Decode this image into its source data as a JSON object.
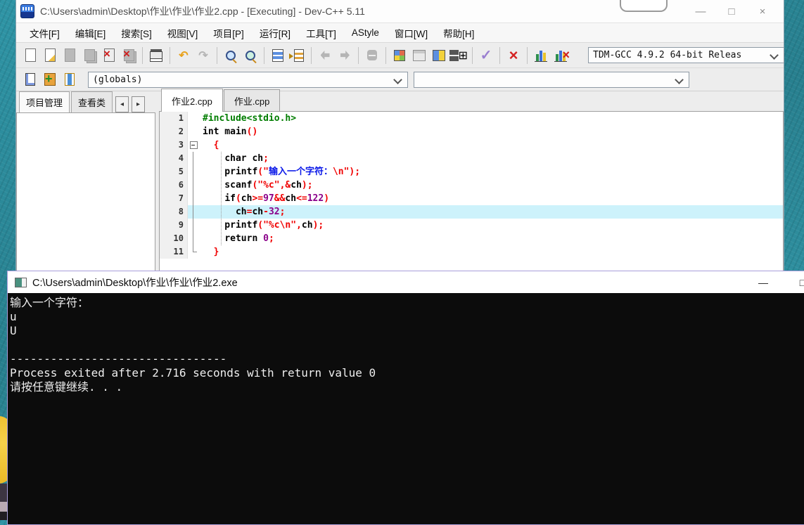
{
  "devcpp": {
    "title": "C:\\Users\\admin\\Desktop\\作业\\作业\\作业2.cpp - [Executing] - Dev-C++ 5.11",
    "window_buttons": {
      "minimize": "—",
      "maximize": "□",
      "close": "×"
    },
    "menu": [
      "文件[F]",
      "编辑[E]",
      "搜索[S]",
      "视图[V]",
      "项目[P]",
      "运行[R]",
      "工具[T]",
      "AStyle",
      "窗口[W]",
      "帮助[H]"
    ],
    "toolbar_main": [
      {
        "name": "new-source",
        "kind": "page"
      },
      {
        "name": "open",
        "kind": "page-open"
      },
      {
        "name": "save",
        "kind": "page-gray"
      },
      {
        "name": "save-all",
        "kind": "pages-gray"
      },
      {
        "name": "close",
        "kind": "page-x"
      },
      {
        "name": "close-all",
        "kind": "pages-x"
      },
      {
        "kind": "sep"
      },
      {
        "name": "print",
        "kind": "printer"
      },
      {
        "kind": "sep"
      },
      {
        "name": "undo",
        "kind": "undo",
        "glyph": "↶"
      },
      {
        "name": "redo",
        "kind": "redo",
        "glyph": "↷"
      },
      {
        "kind": "sep"
      },
      {
        "name": "find",
        "kind": "find"
      },
      {
        "name": "find-in-files",
        "kind": "findfiles"
      },
      {
        "kind": "sep"
      },
      {
        "name": "goto-line",
        "kind": "gotoline"
      },
      {
        "name": "goto-function",
        "kind": "gotofn"
      },
      {
        "kind": "sep"
      },
      {
        "name": "back",
        "kind": "back"
      },
      {
        "name": "forward",
        "kind": "fwd"
      },
      {
        "kind": "sep"
      },
      {
        "name": "comment",
        "kind": "stopgray"
      },
      {
        "kind": "sep"
      },
      {
        "name": "compile",
        "kind": "compile"
      },
      {
        "name": "run",
        "kind": "run"
      },
      {
        "name": "compile-and-run",
        "kind": "comprun"
      },
      {
        "name": "rebuild-all",
        "kind": "rebuild",
        "glyph": "⊞"
      },
      {
        "kind": "sep"
      },
      {
        "name": "syntax-check",
        "kind": "check",
        "glyph": "✓"
      },
      {
        "kind": "sep"
      },
      {
        "name": "abort-compilation",
        "kind": "abort",
        "glyph": "×"
      },
      {
        "kind": "sep"
      },
      {
        "name": "profile-analysis",
        "kind": "profile"
      },
      {
        "name": "delete-profiling",
        "kind": "profdel"
      }
    ],
    "compiler_combo_value": "TDM-GCC 4.9.2 64-bit Releas",
    "toolbar_project": [
      {
        "name": "new-unit",
        "kind": "newunit"
      },
      {
        "name": "add-to-project",
        "kind": "addfile"
      },
      {
        "name": "remove-from-project",
        "kind": "removefile"
      }
    ],
    "globals_combo_value": "(globals)",
    "members_combo_value": "",
    "left_tabs": [
      {
        "label": "项目管理",
        "active": true
      },
      {
        "label": "查看类",
        "active": false
      }
    ],
    "tab_scroll_buttons": [
      "◂",
      "▸"
    ],
    "editor_tabs": [
      {
        "label": "作业2.cpp",
        "active": true
      },
      {
        "label": "作业.cpp",
        "active": false
      }
    ],
    "code": {
      "lines": [
        {
          "n": "1",
          "fold": "",
          "hl": false,
          "tokens": [
            [
              "g",
              "#include<stdio.h>"
            ]
          ]
        },
        {
          "n": "2",
          "fold": "",
          "hl": false,
          "tokens": [
            [
              "k",
              "int"
            ],
            [
              "p",
              " main"
            ],
            [
              "r",
              "()"
            ]
          ]
        },
        {
          "n": "3",
          "fold": "start",
          "hl": false,
          "tokens": [
            [
              "r",
              "  {"
            ]
          ]
        },
        {
          "n": "4",
          "fold": "mid",
          "hl": false,
          "tokens": [
            [
              "p",
              "    "
            ],
            [
              "k",
              "char"
            ],
            [
              "p",
              " ch"
            ],
            [
              "r",
              ";"
            ]
          ]
        },
        {
          "n": "5",
          "fold": "mid",
          "hl": false,
          "tokens": [
            [
              "p",
              "    printf"
            ],
            [
              "r",
              "(\""
            ],
            [
              "b",
              "输入一个字符："
            ],
            [
              "r",
              "\\n\");"
            ]
          ]
        },
        {
          "n": "6",
          "fold": "mid",
          "hl": false,
          "tokens": [
            [
              "p",
              "    scanf"
            ],
            [
              "r",
              "(\"%c\",&"
            ],
            [
              "p",
              "ch"
            ],
            [
              "r",
              ");"
            ]
          ]
        },
        {
          "n": "7",
          "fold": "mid",
          "hl": false,
          "tokens": [
            [
              "p",
              "    "
            ],
            [
              "k",
              "if"
            ],
            [
              "r",
              "("
            ],
            [
              "p",
              "ch"
            ],
            [
              "r",
              ">="
            ],
            [
              "n",
              "97"
            ],
            [
              "r",
              "&&"
            ],
            [
              "p",
              "ch"
            ],
            [
              "r",
              "<="
            ],
            [
              "n",
              "122"
            ],
            [
              "r",
              ")"
            ]
          ]
        },
        {
          "n": "8",
          "fold": "mid",
          "hl": true,
          "tokens": [
            [
              "p",
              "      ch"
            ],
            [
              "r",
              "="
            ],
            [
              "p",
              "ch"
            ],
            [
              "r",
              "-"
            ],
            [
              "n",
              "32"
            ],
            [
              "r",
              ";"
            ]
          ]
        },
        {
          "n": "9",
          "fold": "mid",
          "hl": false,
          "tokens": [
            [
              "p",
              "    printf"
            ],
            [
              "r",
              "(\"%c\\n\","
            ],
            [
              "p",
              "ch"
            ],
            [
              "r",
              ");"
            ]
          ]
        },
        {
          "n": "10",
          "fold": "mid",
          "hl": false,
          "tokens": [
            [
              "p",
              "    "
            ],
            [
              "k",
              "return"
            ],
            [
              "p",
              " "
            ],
            [
              "n",
              "0"
            ],
            [
              "r",
              ";"
            ]
          ]
        },
        {
          "n": "11",
          "fold": "end",
          "hl": false,
          "tokens": [
            [
              "r",
              "  }"
            ]
          ]
        }
      ]
    }
  },
  "console": {
    "title": "C:\\Users\\admin\\Desktop\\作业\\作业\\作业2.exe",
    "window_buttons": {
      "minimize": "—",
      "maximize": "□"
    },
    "lines": [
      "输入一个字符：",
      "u",
      "U",
      "",
      "--------------------------------",
      "Process exited after 2.716 seconds with return value 0",
      "请按任意键继续. . ."
    ]
  },
  "colors": {
    "preprocessor": "#007d00",
    "string": "#f00000",
    "number": "#8a008a",
    "chinese_string": "#0a18e8",
    "line_highlight": "#cdf2fb",
    "console_bg": "#0c0c0c",
    "console_text": "#eeeeee"
  }
}
